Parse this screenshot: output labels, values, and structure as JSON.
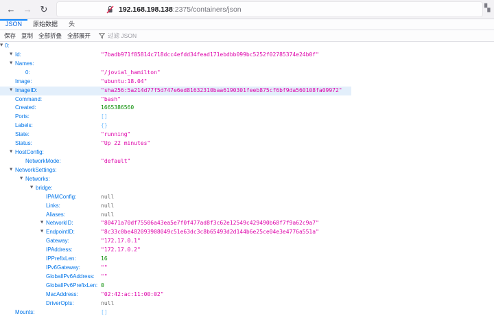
{
  "browser": {
    "back_icon": "back-arrow",
    "forward_icon": "forward-arrow",
    "reload_icon": "reload",
    "url_host": "192.168.198.138",
    "url_path": ":2375/containers/json",
    "insecure_icon": "lock-with-slash"
  },
  "tabs": [
    {
      "label": "JSON",
      "active": true
    },
    {
      "label": "原始数据",
      "active": false
    },
    {
      "label": "头",
      "active": false
    }
  ],
  "toolbar": {
    "buttons": [
      {
        "label": "保存"
      },
      {
        "label": "复制"
      },
      {
        "label": "全部折叠"
      },
      {
        "label": "全部展开"
      }
    ],
    "filter_icon": "funnel",
    "filter_placeholder": "过滤 JSON"
  },
  "colors": {
    "key": "#0074e8",
    "string": "#dd00a9",
    "number": "#058b00",
    "null": "#737373",
    "bracket": "#75bfff",
    "selected_row_bg": "#e3effb",
    "active_tab": "#0060df",
    "tab_accent": "#0a84ff"
  },
  "tree": {
    "rows": [
      {
        "indent": 0,
        "arrow": true,
        "key": "0",
        "value": "",
        "type": "none"
      },
      {
        "indent": 1,
        "arrow": true,
        "key": "Id",
        "value": "\"7badb971f85814c718dcc4efdd34fead171ebdbb099bc5252f02785374e24b0f\"",
        "type": "string"
      },
      {
        "indent": 1,
        "arrow": true,
        "key": "Names",
        "value": "",
        "type": "none"
      },
      {
        "indent": 2,
        "arrow": false,
        "key": "0",
        "value": "\"/jovial_hamilton\"",
        "type": "string"
      },
      {
        "indent": 1,
        "arrow": false,
        "key": "Image",
        "value": "\"ubuntu:18.04\"",
        "type": "string"
      },
      {
        "indent": 1,
        "arrow": true,
        "key": "ImageID",
        "value": "\"sha256:5a214d77f5d747e6ed81632310baa6190301feeb875cf6bf9da560108fa09972\"",
        "type": "string",
        "selected": true
      },
      {
        "indent": 1,
        "arrow": false,
        "key": "Command",
        "value": "\"bash\"",
        "type": "string"
      },
      {
        "indent": 1,
        "arrow": false,
        "key": "Created",
        "value": "1665386560",
        "type": "number"
      },
      {
        "indent": 1,
        "arrow": false,
        "key": "Ports",
        "value": "[]",
        "type": "bracket"
      },
      {
        "indent": 1,
        "arrow": false,
        "key": "Labels",
        "value": "{}",
        "type": "bracket"
      },
      {
        "indent": 1,
        "arrow": false,
        "key": "State",
        "value": "\"running\"",
        "type": "string"
      },
      {
        "indent": 1,
        "arrow": false,
        "key": "Status",
        "value": "\"Up 22 minutes\"",
        "type": "string"
      },
      {
        "indent": 1,
        "arrow": true,
        "key": "HostConfig",
        "value": "",
        "type": "none"
      },
      {
        "indent": 2,
        "arrow": false,
        "key": "NetworkMode",
        "value": "\"default\"",
        "type": "string"
      },
      {
        "indent": 1,
        "arrow": true,
        "key": "NetworkSettings",
        "value": "",
        "type": "none"
      },
      {
        "indent": 2,
        "arrow": true,
        "key": "Networks",
        "value": "",
        "type": "none"
      },
      {
        "indent": 3,
        "arrow": true,
        "key": "bridge",
        "value": "",
        "type": "none"
      },
      {
        "indent": 4,
        "arrow": false,
        "key": "IPAMConfig",
        "value": "null",
        "type": "null"
      },
      {
        "indent": 4,
        "arrow": false,
        "key": "Links",
        "value": "null",
        "type": "null"
      },
      {
        "indent": 4,
        "arrow": false,
        "key": "Aliases",
        "value": "null",
        "type": "null"
      },
      {
        "indent": 4,
        "arrow": true,
        "key": "NetworkID",
        "value": "\"80471a70df75506a43ea5e7f0f477ad8f3c62e12549c429490b68f7f9a62c9a7\"",
        "type": "string"
      },
      {
        "indent": 4,
        "arrow": true,
        "key": "EndpointID",
        "value": "\"8c33c0be482093908049c51e63dc3c8b65493d2d144b6e25ce04e3e4776a551a\"",
        "type": "string"
      },
      {
        "indent": 4,
        "arrow": false,
        "key": "Gateway",
        "value": "\"172.17.0.1\"",
        "type": "string"
      },
      {
        "indent": 4,
        "arrow": false,
        "key": "IPAddress",
        "value": "\"172.17.0.2\"",
        "type": "string"
      },
      {
        "indent": 4,
        "arrow": false,
        "key": "IPPrefixLen",
        "value": "16",
        "type": "number"
      },
      {
        "indent": 4,
        "arrow": false,
        "key": "IPv6Gateway",
        "value": "\"\"",
        "type": "string"
      },
      {
        "indent": 4,
        "arrow": false,
        "key": "GlobalIPv6Address",
        "value": "\"\"",
        "type": "string"
      },
      {
        "indent": 4,
        "arrow": false,
        "key": "GlobalIPv6PrefixLen",
        "value": "0",
        "type": "number"
      },
      {
        "indent": 4,
        "arrow": false,
        "key": "MacAddress",
        "value": "\"02:42:ac:11:00:02\"",
        "type": "string"
      },
      {
        "indent": 4,
        "arrow": false,
        "key": "DriverOpts",
        "value": "null",
        "type": "null"
      },
      {
        "indent": 1,
        "arrow": false,
        "key": "Mounts",
        "value": "[]",
        "type": "bracket"
      }
    ]
  }
}
